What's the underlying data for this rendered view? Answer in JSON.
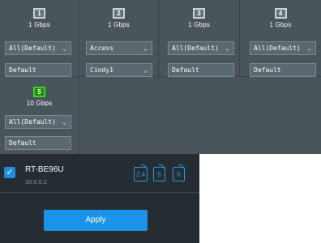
{
  "ports": [
    {
      "number": "1",
      "speed": "1 Gbps",
      "vlan": "All(Default)",
      "profile": "Default"
    },
    {
      "number": "2",
      "speed": "1 Gbps",
      "vlan": "Access",
      "profile": "Cindy1"
    },
    {
      "number": "3",
      "speed": "1 Gbps",
      "vlan": "All(Default)",
      "profile": "Default"
    },
    {
      "number": "4",
      "speed": "1 Gbps",
      "vlan": "All(Default)",
      "profile": "Default"
    },
    {
      "number": "5",
      "speed": "10 Gbps",
      "vlan": "All(Default)",
      "profile": "Default"
    }
  ],
  "device": {
    "name": "RT-BE96U",
    "ip": "10.0.0.2",
    "checked": true,
    "bands": [
      "2.4",
      "5",
      "6"
    ]
  },
  "apply_label": "Apply",
  "colors": {
    "accent": "#1b93ea",
    "port_active": "#39d41f",
    "panel_bg": "#252d32",
    "ports_bg": "#49545b"
  }
}
